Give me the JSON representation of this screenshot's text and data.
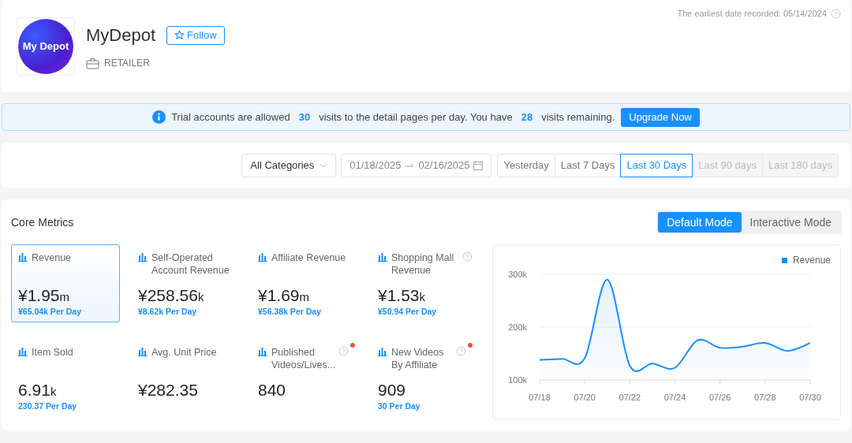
{
  "header": {
    "logo_text": "My Depot",
    "name": "MyDepot",
    "follow_label": "Follow",
    "type": "RETAILER",
    "earliest_date": "The earliest date recorded: 05/14/2024"
  },
  "banner": {
    "parts": [
      {
        "text": "Trial accounts are allowed",
        "kind": "plain"
      },
      {
        "text": "30",
        "kind": "number"
      },
      {
        "text": "visits to the detail pages per day. You have",
        "kind": "plain"
      },
      {
        "text": "28",
        "kind": "number"
      },
      {
        "text": "visits remaining.",
        "kind": "plain"
      }
    ],
    "button": "Upgrade Now"
  },
  "filters": {
    "category": "All Categories",
    "date_from": "01/18/2025",
    "date_to": "02/16/2025",
    "ranges": [
      {
        "label": "Yesterday",
        "selected": false,
        "disabled": false
      },
      {
        "label": "Last 7 Days",
        "selected": false,
        "disabled": false
      },
      {
        "label": "Last 30 Days",
        "selected": true,
        "disabled": false
      },
      {
        "label": "Last 90 days",
        "selected": false,
        "disabled": true
      },
      {
        "label": "Last 180 days",
        "selected": false,
        "disabled": true
      }
    ]
  },
  "core_metrics": {
    "title": "Core Metrics",
    "modes": [
      {
        "label": "Default Mode",
        "selected": true
      },
      {
        "label": "Interactive Mode",
        "selected": false
      }
    ],
    "metrics": [
      {
        "label": "Revenue",
        "value": "¥1.95",
        "unit": "m",
        "per_day": "¥65.04k Per Day",
        "selected": true,
        "help": false,
        "new": false
      },
      {
        "label": "Self-Operated Account Revenue",
        "value": "¥258.56",
        "unit": "k",
        "per_day": "¥8.62k Per Day",
        "selected": false,
        "help": false,
        "new": false
      },
      {
        "label": "Affiliate Revenue",
        "value": "¥1.69",
        "unit": "m",
        "per_day": "¥56.38k Per Day",
        "selected": false,
        "help": false,
        "new": false
      },
      {
        "label": "Shopping Mall Revenue",
        "value": "¥1.53",
        "unit": "k",
        "per_day": "¥50.94 Per Day",
        "selected": false,
        "help": true,
        "new": false
      },
      {
        "label": "Item Sold",
        "value": "6.91",
        "unit": "k",
        "per_day": "230.37 Per Day",
        "selected": false,
        "help": false,
        "new": false
      },
      {
        "label": "Avg. Unit Price",
        "value": "¥282.35",
        "selected": false,
        "help": false,
        "new": false
      },
      {
        "label": "Published Videos/Lives...",
        "value": "840",
        "selected": false,
        "help": true,
        "new": true
      },
      {
        "label": "New Videos By Affiliate",
        "value": "909",
        "per_day": "30 Per Day",
        "selected": false,
        "help": true,
        "new": true
      }
    ],
    "chart_data": {
      "type": "area",
      "categories": [
        "07/18",
        null,
        "07/20",
        null,
        "07/22",
        null,
        "07/24",
        null,
        "07/26",
        null,
        "07/28",
        null,
        "07/30"
      ],
      "series": [
        {
          "name": "Revenue",
          "color": "#1890ff",
          "values": [
            138000,
            140000,
            141000,
            290000,
            127000,
            131000,
            123000,
            175000,
            161000,
            163000,
            170000,
            155000,
            170000
          ]
        }
      ],
      "ylim": [
        100000,
        300000
      ],
      "yticks": [
        {
          "value": 100000,
          "label": "100k"
        },
        {
          "value": 200000,
          "label": "200k"
        },
        {
          "value": 300000,
          "label": "300k"
        }
      ]
    }
  }
}
